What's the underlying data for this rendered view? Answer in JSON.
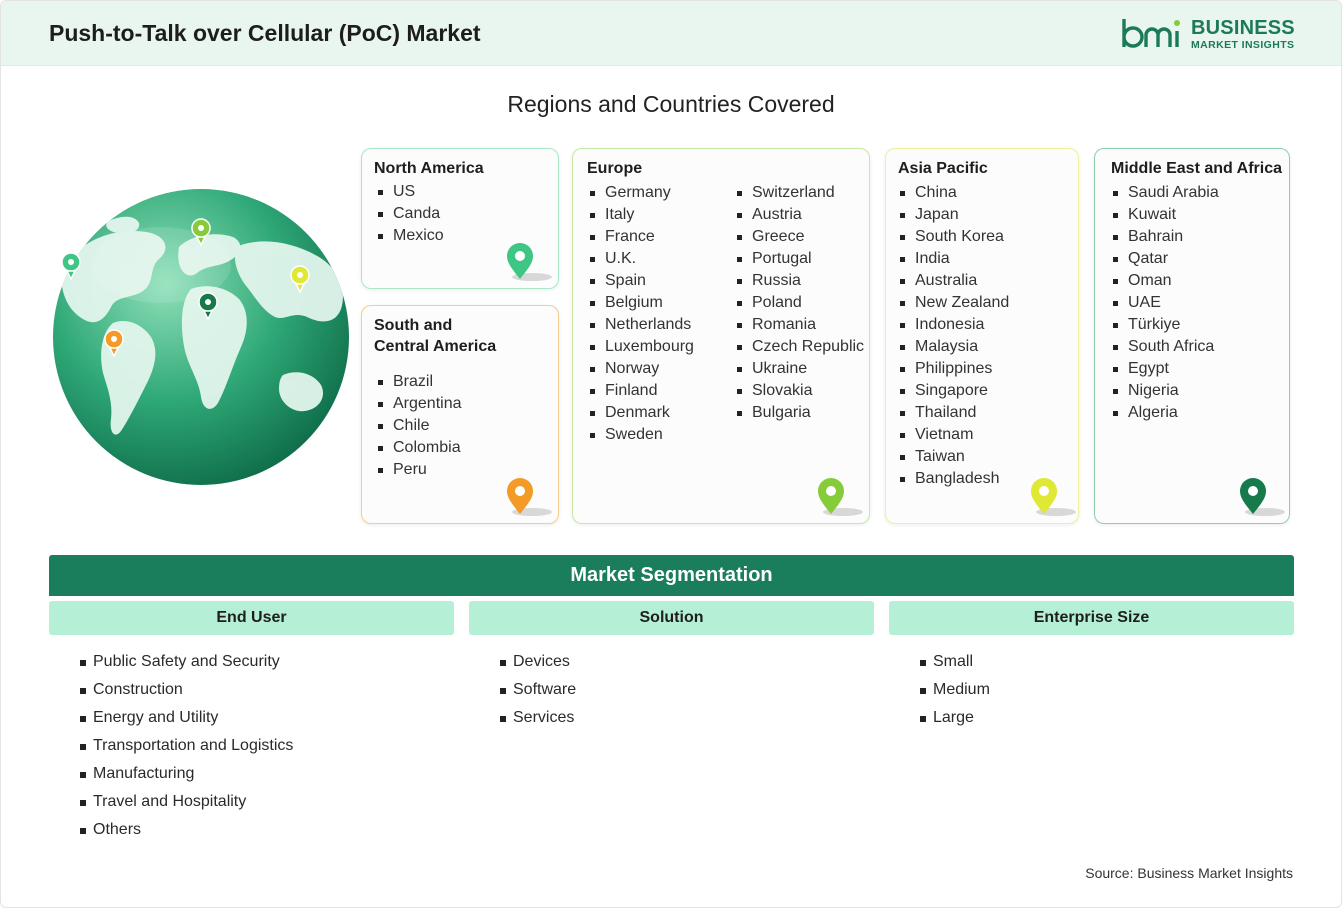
{
  "header": {
    "title": "Push-to-Talk over Cellular (PoC) Market"
  },
  "logo": {
    "name": "BUSINESS",
    "sub": "MARKET INSIGHTS",
    "mark": "bmi"
  },
  "colors": {
    "brand": "#1a7d5c",
    "segment_head": "#b5f0d6",
    "header_bg": "#e9f6ef",
    "north_america": "#3ec784",
    "south_central_america": "#f39b26",
    "europe": "#86cc3a",
    "asia_pacific": "#dfe834",
    "middle_east_africa": "#167a4a"
  },
  "regions_heading": "Regions and Countries Covered",
  "regions": {
    "north_america": {
      "title": "North America",
      "countries": [
        "US",
        "Canda",
        "Mexico"
      ],
      "pin_icon": "map-pin-icon"
    },
    "south_central_america": {
      "title_line1": "South and",
      "title_line2": "Central America",
      "countries": [
        "Brazil",
        "Argentina",
        "Chile",
        "Colombia",
        "Peru"
      ],
      "pin_icon": "map-pin-icon"
    },
    "europe": {
      "title": "Europe",
      "countries_col1": [
        "Germany",
        "Italy",
        "France",
        "U.K.",
        "Spain",
        "Belgium",
        "Netherlands",
        "Luxembourg",
        "Norway",
        "Finland",
        "Denmark",
        "Sweden"
      ],
      "countries_col2": [
        "Switzerland",
        "Austria",
        "Greece",
        "Portugal",
        "Russia",
        "Poland",
        "Romania",
        "Czech Republic",
        "Ukraine",
        "Slovakia",
        "Bulgaria"
      ],
      "pin_icon": "map-pin-icon"
    },
    "asia_pacific": {
      "title": "Asia Pacific",
      "countries": [
        "China",
        "Japan",
        "South Korea",
        "India",
        "Australia",
        "New Zealand",
        "Indonesia",
        "Malaysia",
        "Philippines",
        "Singapore",
        "Thailand",
        "Vietnam",
        "Taiwan",
        "Bangladesh"
      ],
      "pin_icon": "map-pin-icon"
    },
    "middle_east_africa": {
      "title": "Middle East and Africa",
      "countries": [
        "Saudi Arabia",
        "Kuwait",
        "Bahrain",
        "Qatar",
        "Oman",
        "UAE",
        "Türkiye",
        "South Africa",
        "Egypt",
        "Nigeria",
        "Algeria"
      ],
      "pin_icon": "map-pin-icon"
    }
  },
  "segmentation": {
    "title": "Market Segmentation",
    "columns": [
      {
        "heading": "End User",
        "items": [
          "Public Safety and Security",
          "Construction",
          "Energy and Utility",
          "Transportation and Logistics",
          "Manufacturing",
          "Travel and Hospitality",
          "Others"
        ]
      },
      {
        "heading": "Solution",
        "items": [
          "Devices",
          "Software",
          "Services"
        ]
      },
      {
        "heading": "Enterprise Size",
        "items": [
          "Small",
          "Medium",
          "Large"
        ]
      }
    ]
  },
  "source": "Source: Business Market Insights"
}
